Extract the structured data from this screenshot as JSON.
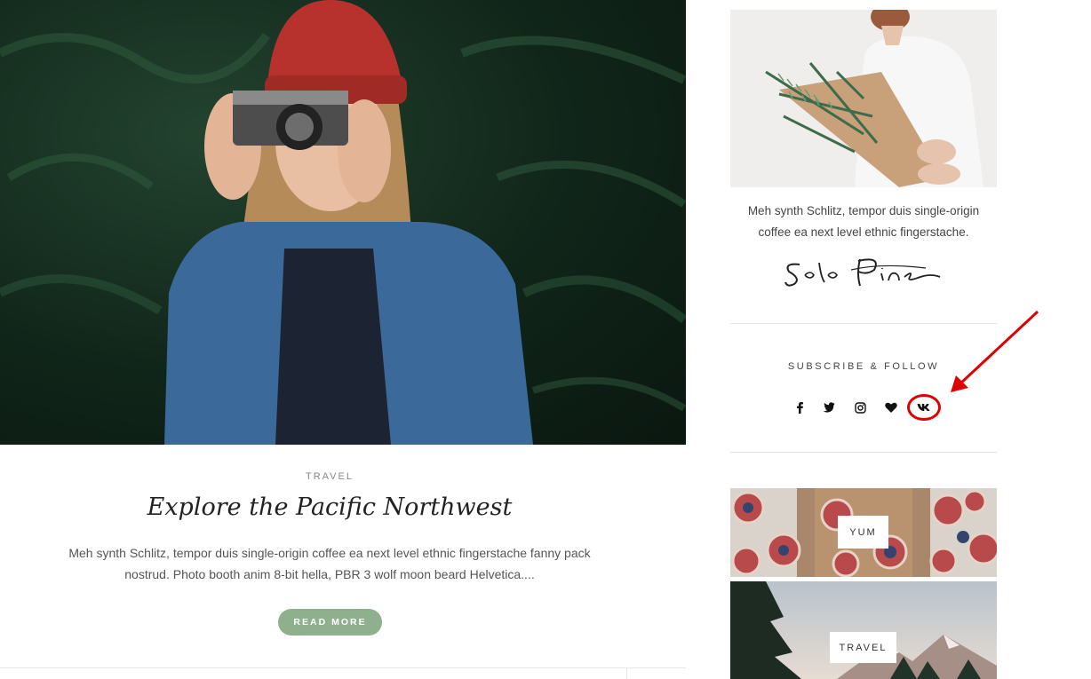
{
  "post": {
    "category": "TRAVEL",
    "title": "Explore the Pacific Northwest",
    "excerpt": "Meh synth Schlitz, tempor duis single-origin coffee ea next level ethnic fingerstache fanny pack nostrud. Photo booth anim 8-bit hella, PBR 3 wolf moon beard Helvetica....",
    "read_more_label": "READ MORE"
  },
  "about": {
    "text": "Meh synth Schlitz, tempor duis single-origin coffee ea next level ethnic fingerstache.",
    "signature": "Solo Pine"
  },
  "subscribe": {
    "heading": "SUBSCRIBE & FOLLOW",
    "icons": [
      "facebook-icon",
      "twitter-icon",
      "instagram-icon",
      "heart-icon",
      "vk-icon"
    ]
  },
  "categories": [
    {
      "label": "YUM"
    },
    {
      "label": "TRAVEL"
    }
  ],
  "colors": {
    "accent": "#8fb08d",
    "highlight": "#e00000"
  }
}
